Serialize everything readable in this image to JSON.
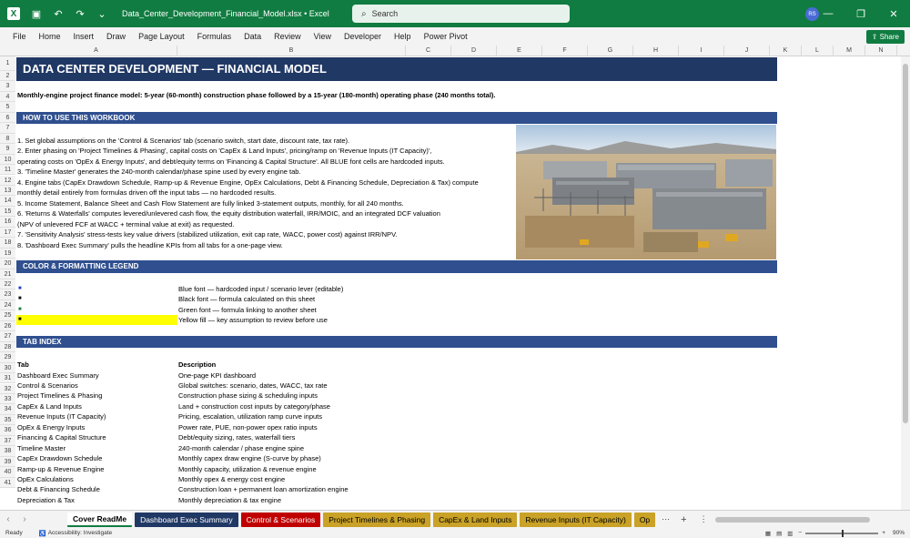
{
  "window": {
    "file_name": "Data_Center_Development_Financial_Model.xlsx",
    "app": "Excel",
    "search_placeholder": "Search",
    "user_initials": "RS"
  },
  "menu": [
    "File",
    "Home",
    "Insert",
    "Draw",
    "Page Layout",
    "Formulas",
    "Data",
    "Review",
    "View",
    "Developer",
    "Help",
    "Power Pivot"
  ],
  "share_label": "Share",
  "columns": [
    "A",
    "B",
    "C",
    "D",
    "E",
    "F",
    "G",
    "H",
    "I",
    "J",
    "K",
    "L",
    "M",
    "N"
  ],
  "rows": [
    "1",
    "2",
    "3",
    "4",
    "5",
    "6",
    "7",
    "8",
    "9",
    "10",
    "11",
    "12",
    "13",
    "14",
    "15",
    "16",
    "17",
    "18",
    "19",
    "20",
    "21",
    "22",
    "23",
    "24",
    "25",
    "26",
    "27",
    "28",
    "29",
    "30",
    "31",
    "32",
    "33",
    "34",
    "35",
    "36",
    "37",
    "38",
    "39",
    "40",
    "41"
  ],
  "sheet": {
    "title": "DATA CENTER DEVELOPMENT — FINANCIAL MODEL",
    "subtitle": "Monthly-engine project finance model: 5-year (60-month) construction phase followed by a 15-year (180-month) operating phase (240 months total).",
    "how_header": "HOW TO USE THIS WORKBOOK",
    "how_lines": [
      "1. Set global assumptions on the 'Control & Scenarios' tab (scenario switch, start date, discount rate, tax rate).",
      "2. Enter phasing on 'Project Timelines & Phasing', capital costs on 'CapEx & Land Inputs', pricing/ramp on 'Revenue Inputs (IT Capacity)',",
      "   operating costs on 'OpEx & Energy Inputs', and debt/equity terms on 'Financing & Capital Structure'. All BLUE font cells are hardcoded inputs.",
      "3. 'Timeline Master' generates the 240-month calendar/phase spine used by every engine tab.",
      "4. Engine tabs (CapEx Drawdown Schedule, Ramp-up & Revenue Engine, OpEx Calculations, Debt & Financing Schedule, Depreciation & Tax) compute",
      "   monthly detail entirely from formulas driven off the input tabs — no hardcoded results.",
      "5. Income Statement, Balance Sheet and Cash Flow Statement are fully linked 3-statement outputs, monthly, for all 240 months.",
      "6. 'Returns & Waterfalls' computes levered/unlevered cash flow, the equity distribution waterfall, IRR/MOIC, and an integrated DCF valuation",
      "   (NPV of unlevered FCF at WACC + terminal value at exit) as requested.",
      "7. 'Sensitivity Analysis' stress-tests key value drivers (stabilized utilization, exit cap rate, WACC, power cost) against IRR/NPV.",
      "8. 'Dashboard Exec Summary' pulls the headline KPIs from all tabs for a one-page view."
    ],
    "legend_header": "COLOR & FORMATTING LEGEND",
    "legend": [
      {
        "marker": "■",
        "text": "Blue font — hardcoded input / scenario lever (editable)",
        "color": "#1f3fbf"
      },
      {
        "marker": "■",
        "text": "Black font — formula calculated on this sheet",
        "color": "#000000"
      },
      {
        "marker": "■",
        "text": "Green font — formula linking to another sheet",
        "color": "#1e7b34"
      },
      {
        "marker": "■",
        "text": "Yellow fill — key assumption to review before use",
        "color": "#000000"
      }
    ],
    "tab_header": "TAB INDEX",
    "tab_col_tab": "Tab",
    "tab_col_desc": "Description",
    "tab_index": [
      {
        "tab": "Dashboard Exec Summary",
        "desc": "One-page KPI dashboard"
      },
      {
        "tab": "Control & Scenarios",
        "desc": "Global switches: scenario, dates, WACC, tax rate"
      },
      {
        "tab": "Project Timelines & Phasing",
        "desc": "Construction phase sizing & scheduling inputs"
      },
      {
        "tab": "CapEx & Land Inputs",
        "desc": "Land + construction cost inputs by category/phase"
      },
      {
        "tab": "Revenue Inputs (IT Capacity)",
        "desc": "Pricing, escalation, utilization ramp curve inputs"
      },
      {
        "tab": "OpEx & Energy Inputs",
        "desc": "Power rate, PUE, non-power opex ratio inputs"
      },
      {
        "tab": "Financing & Capital Structure",
        "desc": "Debt/equity sizing, rates, waterfall tiers"
      },
      {
        "tab": "Timeline Master",
        "desc": "240-month calendar / phase engine spine"
      },
      {
        "tab": "CapEx Drawdown Schedule",
        "desc": "Monthly capex draw engine (S-curve by phase)"
      },
      {
        "tab": "Ramp-up & Revenue Engine",
        "desc": "Monthly capacity, utilization & revenue engine"
      },
      {
        "tab": "OpEx Calculations",
        "desc": "Monthly opex & energy cost engine"
      },
      {
        "tab": "Debt & Financing Schedule",
        "desc": "Construction loan + permanent loan amortization engine"
      },
      {
        "tab": "Depreciation & Tax",
        "desc": "Monthly depreciation & tax engine"
      }
    ]
  },
  "sheet_tabs": [
    {
      "label": "Cover ReadMe",
      "bg": "#ffffff",
      "fg": "#000000"
    },
    {
      "label": "Dashboard Exec Summary",
      "bg": "#203864",
      "fg": "#ffffff"
    },
    {
      "label": "Control & Scenarios",
      "bg": "#c00000",
      "fg": "#ffffff"
    },
    {
      "label": "Project Timelines & Phasing",
      "bg": "#c9a227",
      "fg": "#000000"
    },
    {
      "label": "CapEx & Land Inputs",
      "bg": "#c9a227",
      "fg": "#000000"
    },
    {
      "label": "Revenue Inputs (IT Capacity)",
      "bg": "#c9a227",
      "fg": "#000000"
    },
    {
      "label": "Op",
      "bg": "#c9a227",
      "fg": "#000000"
    }
  ],
  "status": {
    "ready": "Ready",
    "accessibility": "Accessibility: Investigate",
    "zoom": "90%"
  }
}
